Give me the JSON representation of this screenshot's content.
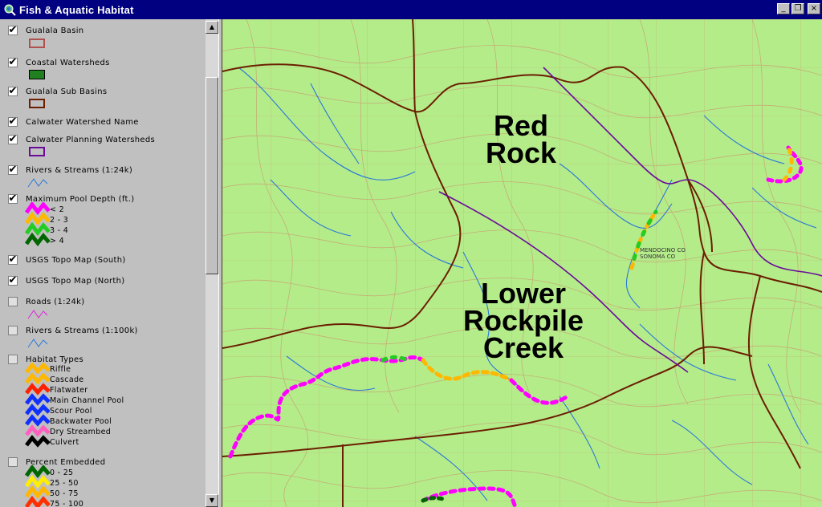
{
  "window": {
    "title": "Fish & Aquatic Habitat",
    "minimize": "_",
    "restore": "❐",
    "close": "×"
  },
  "toc": {
    "layers": [
      {
        "label": "Gualala Basin",
        "checked": true
      },
      {
        "label": "Coastal Watersheds",
        "checked": true
      },
      {
        "label": "Gualala Sub Basins",
        "checked": true
      },
      {
        "label": "Calwater Watershed Name",
        "checked": true
      },
      {
        "label": "Calwater Planning Watersheds",
        "checked": true
      },
      {
        "label": "Rivers & Streams (1:24k)",
        "checked": true
      },
      {
        "label": "Maximum Pool Depth (ft.)",
        "checked": true,
        "classes": [
          "< 2",
          "2 - 3",
          "3 - 4",
          "> 4"
        ]
      },
      {
        "label": "USGS Topo Map (South)",
        "checked": true
      },
      {
        "label": "USGS Topo Map (North)",
        "checked": true
      },
      {
        "label": "Roads (1:24k)",
        "checked": false
      },
      {
        "label": "Rivers & Streams (1:100k)",
        "checked": false
      },
      {
        "label": "Habitat Types",
        "checked": false,
        "classes": [
          "Riffle",
          "Cascade",
          "Flatwater",
          "Main Channel Pool",
          "Scour Pool",
          "Backwater Pool",
          "Dry Streambed",
          "Culvert"
        ]
      },
      {
        "label": "Percent Embedded",
        "checked": false,
        "classes": [
          "0 - 25",
          "25 - 50",
          "50 - 75",
          "75 - 100"
        ]
      }
    ],
    "check_glyph": "✔"
  },
  "scrollbar": {
    "up": "▲",
    "down": "▼"
  },
  "map": {
    "labels": {
      "red_rock": "Red\nRock",
      "lower_rockpile": "Lower\nRockpile\nCreek"
    },
    "colors": {
      "topo_bg": "#b4ec8a",
      "contour": "#c8a070",
      "stream": "#2a78d8",
      "watershed": "#6b1e00",
      "planning": "#6a0a9a",
      "pool_lt2": "#ff00ff",
      "pool_2_3": "#ffb800",
      "pool_3_4": "#22cc22",
      "pool_gt4": "#006600"
    }
  }
}
